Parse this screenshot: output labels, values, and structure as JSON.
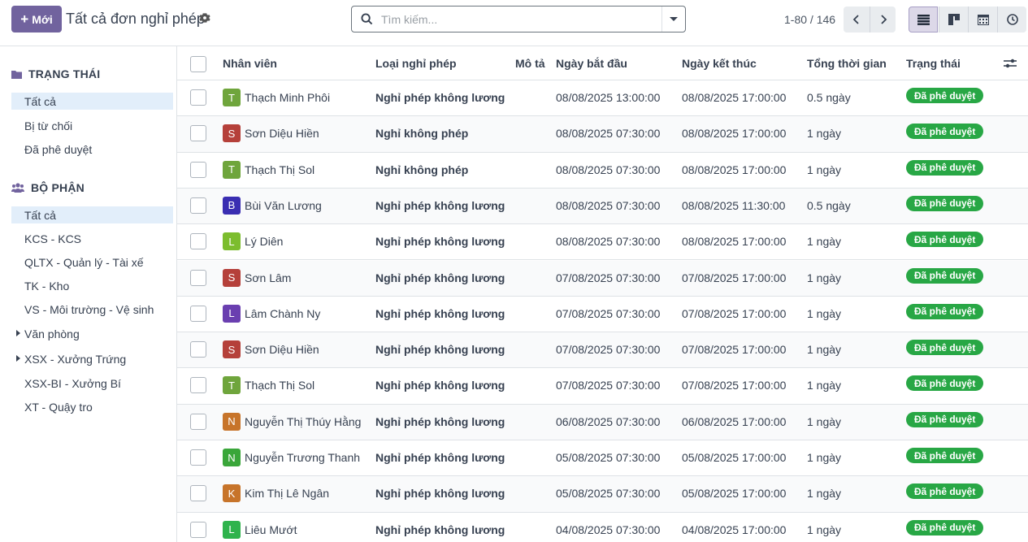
{
  "header": {
    "new_label": "Mới",
    "title": "Tất cả đơn nghỉ phép",
    "search_placeholder": "Tìm kiếm...",
    "pager_text": "1-80 / 146"
  },
  "sidebar": {
    "status": {
      "title": "TRẠNG THÁI",
      "items": [
        {
          "label": "Tất cả",
          "active": true
        },
        {
          "label": "Bị từ chối"
        },
        {
          "label": "Đã phê duyệt"
        }
      ]
    },
    "department": {
      "title": "BỘ PHẬN",
      "items": [
        {
          "label": "Tất cả",
          "active": true
        },
        {
          "label": "KCS - KCS"
        },
        {
          "label": "QLTX - Quản lý - Tài xế"
        },
        {
          "label": "TK - Kho"
        },
        {
          "label": "VS - Môi trường - Vệ sinh"
        },
        {
          "label": "Văn phòng",
          "expandable": true
        },
        {
          "label": "XSX - Xưởng Trứng",
          "expandable": true
        },
        {
          "label": "XSX-BI - Xưởng Bí"
        },
        {
          "label": "XT - Quậy tro"
        }
      ]
    }
  },
  "table": {
    "columns": {
      "employee": "Nhân viên",
      "type": "Loại nghỉ phép",
      "description": "Mô tả",
      "start": "Ngày bắt đầu",
      "end": "Ngày kết thúc",
      "duration": "Tổng thời gian",
      "status": "Trạng thái"
    },
    "rows": [
      {
        "initial": "T",
        "color": "#6fa53c",
        "employee": "Thạch Minh Phôi",
        "type": "Nghỉ phép không lương",
        "start": "08/08/2025 13:00:00",
        "end": "08/08/2025 17:00:00",
        "duration": "0.5 ngày",
        "status": "Đã phê duyệt"
      },
      {
        "initial": "S",
        "color": "#b5403a",
        "employee": "Sơn Diệu Hiền",
        "type": "Nghỉ không phép",
        "start": "08/08/2025 07:30:00",
        "end": "08/08/2025 17:00:00",
        "duration": "1 ngày",
        "status": "Đã phê duyệt"
      },
      {
        "initial": "T",
        "color": "#6fa53c",
        "employee": "Thạch Thị Sol",
        "type": "Nghỉ không phép",
        "start": "08/08/2025 07:30:00",
        "end": "08/08/2025 17:00:00",
        "duration": "1 ngày",
        "status": "Đã phê duyệt"
      },
      {
        "initial": "B",
        "color": "#3a2eb2",
        "employee": "Bùi Văn Lương",
        "type": "Nghỉ phép không lương",
        "start": "08/08/2025 07:30:00",
        "end": "08/08/2025 11:30:00",
        "duration": "0.5 ngày",
        "status": "Đã phê duyệt"
      },
      {
        "initial": "L",
        "color": "#7cbd2e",
        "employee": "Lý Diên",
        "type": "Nghỉ phép không lương",
        "start": "08/08/2025 07:30:00",
        "end": "08/08/2025 17:00:00",
        "duration": "1 ngày",
        "status": "Đã phê duyệt"
      },
      {
        "initial": "S",
        "color": "#b5403a",
        "employee": "Sơn Lâm",
        "type": "Nghỉ phép không lương",
        "start": "07/08/2025 07:30:00",
        "end": "07/08/2025 17:00:00",
        "duration": "1 ngày",
        "status": "Đã phê duyệt"
      },
      {
        "initial": "L",
        "color": "#6a3fb0",
        "employee": "Lâm Chành Ny",
        "type": "Nghỉ phép không lương",
        "start": "07/08/2025 07:30:00",
        "end": "07/08/2025 17:00:00",
        "duration": "1 ngày",
        "status": "Đã phê duyệt"
      },
      {
        "initial": "S",
        "color": "#b5403a",
        "employee": "Sơn Diệu Hiền",
        "type": "Nghỉ phép không lương",
        "start": "07/08/2025 07:30:00",
        "end": "07/08/2025 17:00:00",
        "duration": "1 ngày",
        "status": "Đã phê duyệt"
      },
      {
        "initial": "T",
        "color": "#6fa53c",
        "employee": "Thạch Thị Sol",
        "type": "Nghỉ phép không lương",
        "start": "07/08/2025 07:30:00",
        "end": "07/08/2025 17:00:00",
        "duration": "1 ngày",
        "status": "Đã phê duyệt"
      },
      {
        "initial": "N",
        "color": "#c7742a",
        "employee": "Nguyễn Thị Thúy Hằng",
        "type": "Nghỉ phép không lương",
        "start": "06/08/2025 07:30:00",
        "end": "06/08/2025 17:00:00",
        "duration": "1 ngày",
        "status": "Đã phê duyệt"
      },
      {
        "initial": "N",
        "color": "#3aa63a",
        "employee": "Nguyễn Trương Thanh",
        "type": "Nghỉ phép không lương",
        "start": "05/08/2025 07:30:00",
        "end": "05/08/2025 17:00:00",
        "duration": "1 ngày",
        "status": "Đã phê duyệt"
      },
      {
        "initial": "K",
        "color": "#c7742a",
        "employee": "Kim Thị Lê Ngân",
        "type": "Nghỉ phép không lương",
        "start": "05/08/2025 07:30:00",
        "end": "05/08/2025 17:00:00",
        "duration": "1 ngày",
        "status": "Đã phê duyệt"
      },
      {
        "initial": "L",
        "color": "#2fb34d",
        "employee": "Liêu Mướt",
        "type": "Nghỉ phép không lương",
        "start": "04/08/2025 07:30:00",
        "end": "04/08/2025 17:00:00",
        "duration": "1 ngày",
        "status": "Đã phê duyệt"
      }
    ]
  },
  "colors": {
    "primary": "#71639e",
    "approved": "#28a745",
    "active_filter": "#e2eefa"
  }
}
